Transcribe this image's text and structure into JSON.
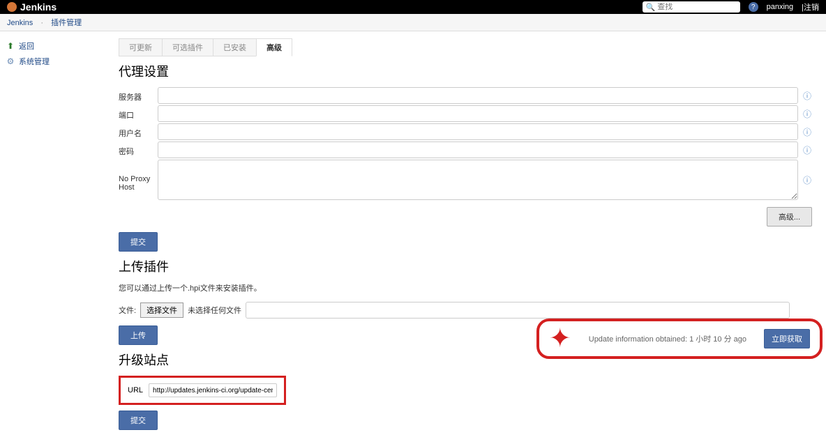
{
  "header": {
    "brand": "Jenkins",
    "search_placeholder": "查找",
    "user": "panxing",
    "logout": "|注销"
  },
  "breadcrumb": {
    "items": [
      "Jenkins",
      "插件管理"
    ]
  },
  "sidebar": {
    "items": [
      {
        "label": "返回"
      },
      {
        "label": "系统管理"
      }
    ]
  },
  "tabs": {
    "items": [
      "可更新",
      "可选插件",
      "已安装",
      "高级"
    ],
    "active": 3
  },
  "proxy_section": {
    "title": "代理设置",
    "labels": {
      "server": "服务器",
      "port": "端口",
      "user": "用户名",
      "password": "密码",
      "no_proxy": "No Proxy Host"
    },
    "advanced_btn": "高级...",
    "submit_btn": "提交"
  },
  "upload_section": {
    "title": "上传插件",
    "subtitle": "您可以通过上传一个.hpi文件来安装插件。",
    "file_label": "文件:",
    "choose_file_btn": "选择文件",
    "no_file_text": "未选择任何文件",
    "upload_btn": "上传"
  },
  "update_site": {
    "title": "升级站点",
    "url_label": "URL",
    "url_value": "http://updates.jenkins-ci.org/update-center.json",
    "submit_btn": "提交"
  },
  "footer": {
    "update_info": "Update information obtained: 1 小时 10 分 ago",
    "check_btn": "立即获取"
  }
}
